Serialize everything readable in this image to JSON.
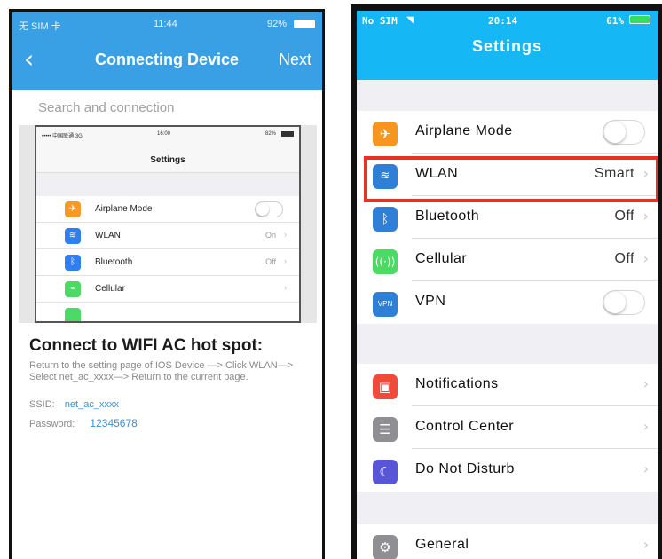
{
  "left_phone": {
    "status": {
      "carrier": "无 SIM 卡",
      "time": "11:44",
      "battery": "92%"
    },
    "nav": {
      "back_icon": "chevron-left-icon",
      "title": "Connecting Device",
      "next_label": "Next"
    },
    "search_label": "Search and connection",
    "mini_screenshot": {
      "status": {
        "carrier": "••••• 中国联通 3G",
        "time": "16:00",
        "battery": "82%"
      },
      "title": "Settings",
      "rows": [
        {
          "label": "Airplane Mode",
          "value": "",
          "icon": "airplane-icon",
          "color": "#f59a23"
        },
        {
          "label": "WLAN",
          "value": "On",
          "icon": "wifi-icon",
          "color": "#2f7ff2"
        },
        {
          "label": "Bluetooth",
          "value": "Off",
          "icon": "bluetooth-icon",
          "color": "#2f7ff2"
        },
        {
          "label": "Cellular",
          "value": "",
          "icon": "cellular-icon",
          "color": "#4cd964"
        }
      ]
    },
    "instructions": {
      "title": "Connect to WIFI AC hot spot:",
      "body": "Return to the setting page of IOS Device —> Click WLAN—> Select net_ac_xxxx—> Return to the current page.",
      "ssid_label": "SSID:",
      "ssid_value": "net_ac_xxxx",
      "password_label": "Password:",
      "password_value": "12345678"
    }
  },
  "right_phone": {
    "status": {
      "carrier": "No SIM",
      "time": "20:14",
      "battery": "61%"
    },
    "title": "Settings",
    "groups": [
      [
        {
          "label": "Airplane Mode",
          "value": "",
          "control": "toggle-off",
          "icon": "airplane-icon",
          "color": "#f5961e"
        },
        {
          "label": "WLAN",
          "value": "Smart",
          "control": "chevron",
          "icon": "wifi-icon",
          "color": "#2f7fd6"
        },
        {
          "label": "Bluetooth",
          "value": "Off",
          "control": "chevron",
          "icon": "bluetooth-icon",
          "color": "#2f7fd6"
        },
        {
          "label": "Cellular",
          "value": "Off",
          "control": "chevron",
          "icon": "cellular-icon",
          "color": "#4cd964"
        },
        {
          "label": "VPN",
          "value": "",
          "control": "toggle-off",
          "icon": "vpn-icon",
          "color": "#2f7fd6"
        }
      ],
      [
        {
          "label": "Notifications",
          "value": "",
          "control": "chevron",
          "icon": "notifications-icon",
          "color": "#f24a3a"
        },
        {
          "label": "Control Center",
          "value": "",
          "control": "chevron",
          "icon": "control-center-icon",
          "color": "#8e8e93"
        },
        {
          "label": "Do Not Disturb",
          "value": "",
          "control": "chevron",
          "icon": "moon-icon",
          "color": "#5856d6"
        }
      ],
      [
        {
          "label": "General",
          "value": "",
          "control": "chevron",
          "icon": "gear-icon",
          "color": "#8e8e93"
        }
      ]
    ],
    "highlight_color": "#e8321f"
  }
}
